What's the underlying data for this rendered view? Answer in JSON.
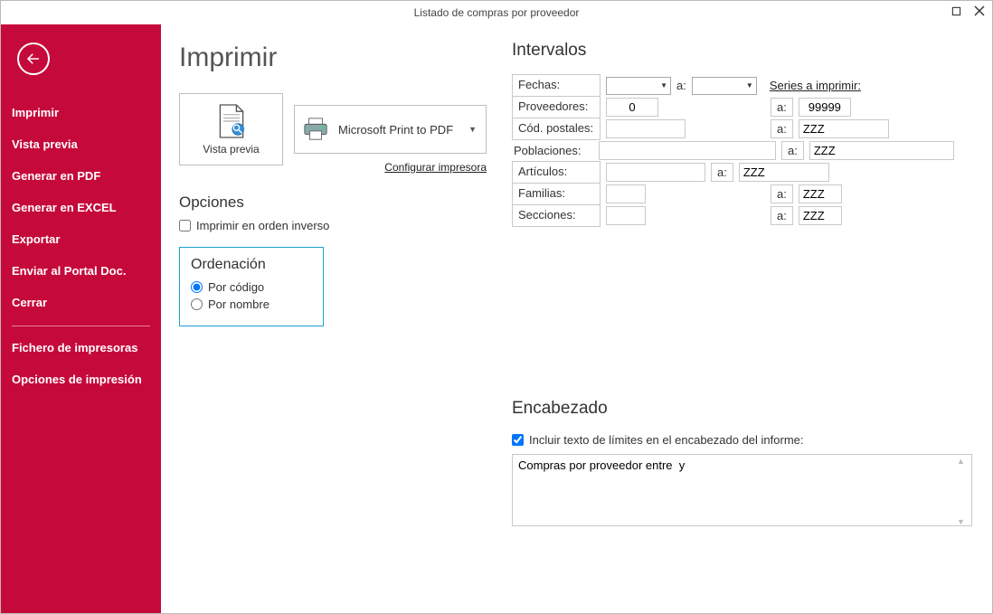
{
  "window": {
    "title": "Listado de compras por proveedor"
  },
  "sidebar": {
    "items": [
      "Imprimir",
      "Vista previa",
      "Generar en PDF",
      "Generar en EXCEL",
      "Exportar",
      "Enviar al Portal Doc.",
      "Cerrar"
    ],
    "items2": [
      "Fichero de impresoras",
      "Opciones de impresión"
    ]
  },
  "page": {
    "title": "Imprimir",
    "vista_previa": "Vista previa",
    "printer_name": "Microsoft Print to PDF",
    "configurar": "Configurar impresora"
  },
  "opciones": {
    "heading": "Opciones",
    "reverse": "Imprimir en orden inverso"
  },
  "orden": {
    "heading": "Ordenación",
    "por_codigo": "Por código",
    "por_nombre": "Por nombre",
    "selected": "codigo"
  },
  "intervalos": {
    "heading": "Intervalos",
    "a_label": "a:",
    "series_link": "Series a imprimir:",
    "fechas": {
      "label": "Fechas:",
      "from": "",
      "to": ""
    },
    "proveedores": {
      "label": "Proveedores:",
      "from": "0",
      "to": "99999"
    },
    "cod_postales": {
      "label": "Cód. postales:",
      "from": "",
      "to": "ZZZ"
    },
    "poblaciones": {
      "label": "Poblaciones:",
      "from": "",
      "to": "ZZZ"
    },
    "articulos": {
      "label": "Artículos:",
      "from": "",
      "to": "ZZZ"
    },
    "familias": {
      "label": "Familias:",
      "from": "",
      "to": "ZZZ"
    },
    "secciones": {
      "label": "Secciones:",
      "from": "",
      "to": "ZZZ"
    }
  },
  "encabezado": {
    "heading": "Encabezado",
    "incluir": "Incluir texto de límites en el encabezado del informe:",
    "texto": "Compras por proveedor entre  y"
  }
}
